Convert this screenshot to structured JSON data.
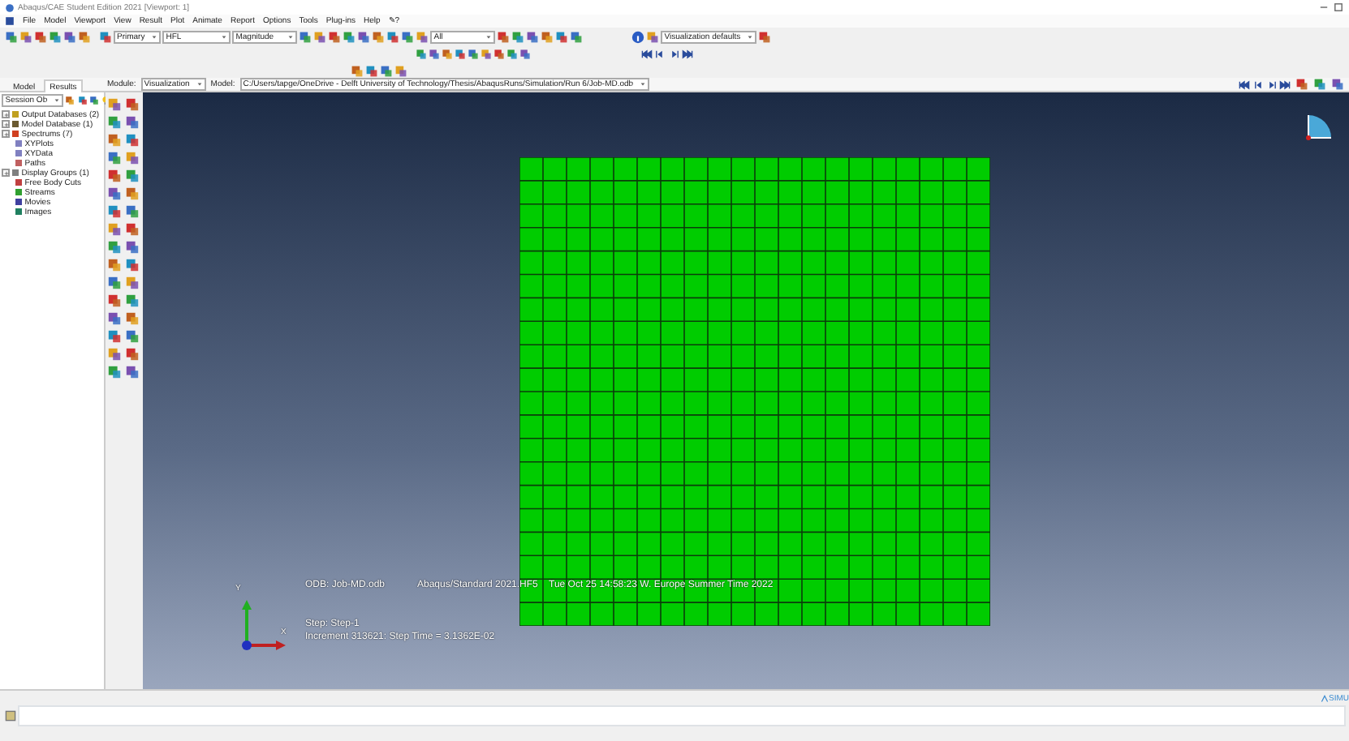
{
  "window": {
    "title": "Abaqus/CAE Student Edition 2021 [Viewport: 1]"
  },
  "menu": [
    "File",
    "Model",
    "Viewport",
    "View",
    "Result",
    "Plot",
    "Animate",
    "Report",
    "Options",
    "Tools",
    "Plug-ins",
    "Help",
    "✎?"
  ],
  "toolbar": {
    "dropdowns": [
      "Primary",
      "HFL",
      "Magnitude",
      "All"
    ],
    "defaults_dropdown": "Visualization defaults"
  },
  "module_bar": {
    "module_label": "Module:",
    "module": "Visualization",
    "model_label": "Model:",
    "model": "C:/Users/tapge/OneDrive - Delft University of Technology/Thesis/AbaqusRuns/Simulation/Run 6/Job-MD.odb"
  },
  "left_panel": {
    "tabs": [
      {
        "label": "Model",
        "selected": false
      },
      {
        "label": "Results",
        "selected": true
      }
    ],
    "session": "Session Ob",
    "tree": [
      {
        "label": "Output Databases (2)",
        "expanded": false,
        "color": "#c0a020"
      },
      {
        "label": "Model Database (1)",
        "expanded": false,
        "color": "#6a5a30"
      },
      {
        "label": "Spectrums (7)",
        "expanded": false,
        "color": "#d04020"
      },
      {
        "label": "XYPlots",
        "color": "#8080c0"
      },
      {
        "label": "XYData",
        "color": "#8080c0"
      },
      {
        "label": "Paths",
        "color": "#c06060"
      },
      {
        "label": "Display Groups (1)",
        "expanded": false,
        "color": "#808080"
      },
      {
        "label": "Free Body Cuts",
        "color": "#c04040"
      },
      {
        "label": "Streams",
        "color": "#30a030"
      },
      {
        "label": "Movies",
        "color": "#4040a0"
      },
      {
        "label": "Images",
        "color": "#208060"
      }
    ]
  },
  "viewport": {
    "info": [
      "ODB: Job-MD.odb",
      "Abaqus/Standard 2021.HF5",
      "Tue Oct 25 14:58:23 W. Europe Summer Time 2022"
    ],
    "step": "Step: Step-1",
    "increment": "Increment 313621: Step Time =   3.1362E-02",
    "axis_y": "Y",
    "axis_x": "X"
  },
  "brand": "SIMU"
}
